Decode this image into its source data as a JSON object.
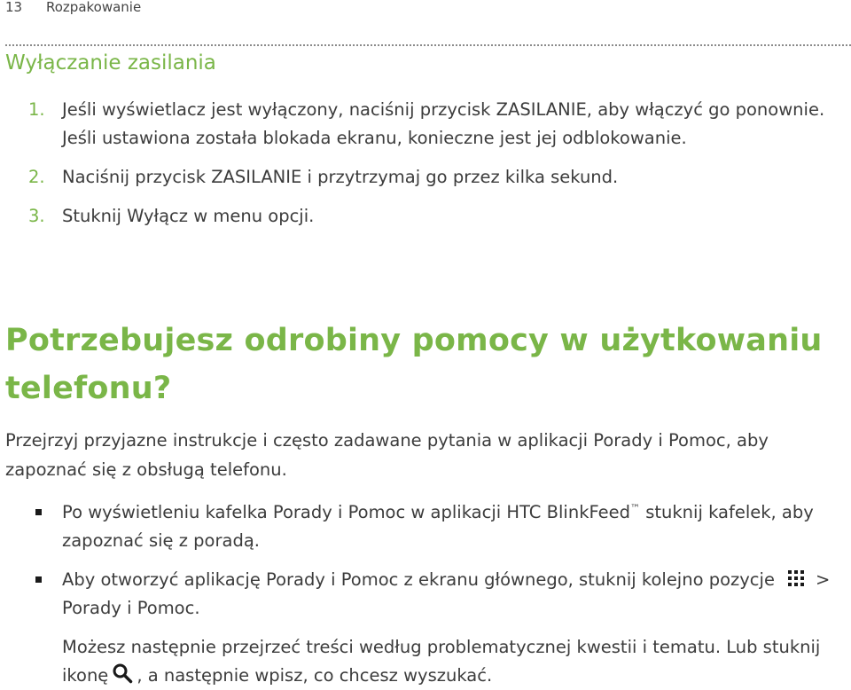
{
  "header": {
    "page_number": "13",
    "chapter": "Rozpakowanie"
  },
  "section": {
    "title": "Wyłączanie zasilania",
    "steps": [
      {
        "num": "1.",
        "text": "Jeśli wyświetlacz jest wyłączony, naciśnij przycisk ZASILANIE, aby włączyć go ponownie. Jeśli ustawiona została blokada ekranu, konieczne jest jej odblokowanie."
      },
      {
        "num": "2.",
        "text": "Naciśnij przycisk ZASILANIE i przytrzymaj go przez kilka sekund."
      },
      {
        "num": "3.",
        "before": "Stuknij ",
        "emph": "Wyłącz",
        "after": " w menu opcji."
      }
    ]
  },
  "help": {
    "title": "Potrzebujesz odrobiny pomocy w użytkowaniu telefonu?",
    "intro": "Przejrzyj przyjazne instrukcje i często zadawane pytania w aplikacji Porady i Pomoc, aby zapoznać się z obsługą telefonu.",
    "bullet1": {
      "before": "Po wyświetleniu kafelka Porady i Pomoc w aplikacji HTC BlinkFeed",
      "tm": "™",
      "after": " stuknij kafelek, aby zapoznać się z poradą."
    },
    "bullet2": {
      "before": "Aby otworzyć aplikację Porady i Pomoc z ekranu głównego, stuknij kolejno pozycje",
      "after": "> Porady i Pomoc."
    },
    "note": {
      "before": "Możesz następnie przejrzeć treści według problematycznej kwestii i tematu. Lub stuknij ikonę",
      "after": ", a następnie wpisz, co chcesz wyszukać."
    }
  },
  "icons": {
    "apps": "apps-grid-icon",
    "search": "search-icon"
  },
  "colors": {
    "accent": "#7ab648",
    "text": "#3c3c3c"
  }
}
